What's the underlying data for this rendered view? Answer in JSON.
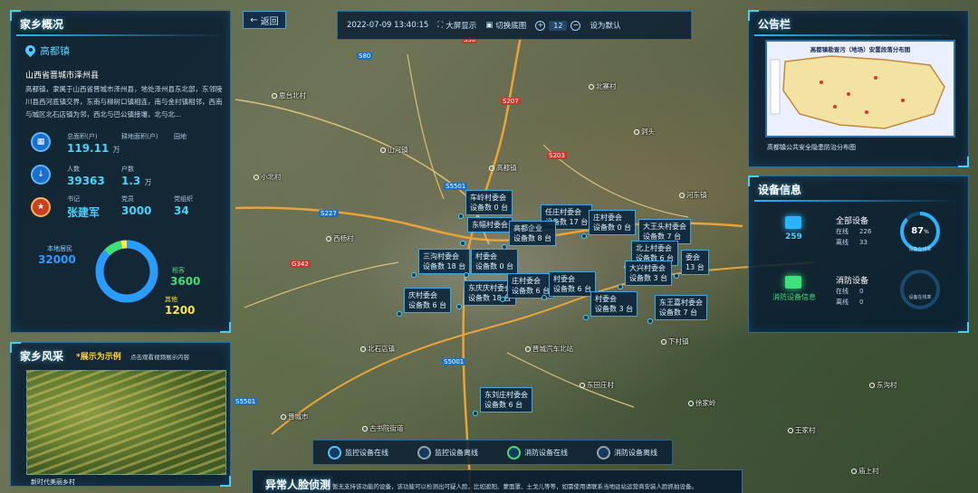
{
  "toolbar": {
    "back_label": "返回",
    "datetime": "2022-07-09 13:40:15",
    "fullscreen_label": "大屏显示",
    "switch_map_label": "切换底图",
    "zoom_level": "12",
    "default_label": "设为默认"
  },
  "home": {
    "title": "家乡概况",
    "town": "高都镇",
    "region": "山西省晋城市泽州县",
    "description": "高都镇，隶属于山西省晋城市泽州县，地处泽州县东北部，东邻陵川县西河底镇交界，东南与柳树口镇相连，南与金村镇相邻，西南与城区北石店镇为邻，西北与巴公镇接壤，北与北...",
    "stats": {
      "area_label": "总面积(户)",
      "area_value": "119.11",
      "area_unit": "万",
      "arable_label": "耕地面积(户)",
      "forest_label": "园地",
      "pop_label": "人数",
      "pop_value": "39363",
      "households_label": "户数",
      "households_value": "1.3",
      "households_unit": "万",
      "secretary_label": "书记",
      "secretary_value": "张建军",
      "party_label": "党员",
      "party_value": "3000",
      "activist_label": "党组织",
      "activist_value": "34"
    },
    "donut": {
      "local_label": "本地居民",
      "local_value": "32000",
      "rent_label": "租客",
      "rent_value": "3600",
      "other_label": "其他",
      "other_value": "1200",
      "local_color": "#2a9cff",
      "rent_color": "#3ee07a",
      "other_color": "#ffe34a"
    }
  },
  "style": {
    "title": "家乡风采",
    "note": "*展示为示例",
    "hint": "点击观看视频展示内容",
    "caption": "新时代美丽乡村"
  },
  "notice": {
    "title": "公告栏",
    "map_title": "高都镇勘查污（地场）安置段落分布图",
    "caption": "高都镇公共安全隐患防治分布图"
  },
  "device": {
    "title": "设备信息",
    "monitor_total": "259",
    "monitor_group": "全部设备",
    "online_label": "在线",
    "online_value": "226",
    "offline_label": "离线",
    "offline_value": "33",
    "online_rate": "87",
    "online_rate_unit": "%",
    "online_rate_label": "设备在线率",
    "fire_group": "消防设备",
    "fire_online": "0",
    "fire_offline": "0",
    "fire_link": "消防设备信息",
    "fire_rate_label": "设备在线率",
    "ring_color": "#2ab4ff",
    "ring_bg": "#1a4a6e"
  },
  "villages": [
    {
      "name": "车岭村委会",
      "count_text": "设备数 0 台"
    },
    {
      "name": "任庄村委会",
      "count_text": "设备数 17 台"
    },
    {
      "name": "庄村委会",
      "count_text": "设备数 0 台"
    },
    {
      "name": "东幅村委会",
      "count_text": ""
    },
    {
      "name": "高都企业",
      "count_text": "设备数 8 台"
    },
    {
      "name": "大王头村委会",
      "count_text": "设备数 7 台"
    },
    {
      "name": "三沟村委会",
      "count_text": "设备数 18 台"
    },
    {
      "name": "村委会",
      "count_text": "设备数 0 台"
    },
    {
      "name": "北上村委会",
      "count_text": "设备数 6 台"
    },
    {
      "name": "大兴村委会",
      "count_text": "设备数 3 台"
    },
    {
      "name": "委会",
      "count_text": "13 台"
    },
    {
      "name": "庆村委会",
      "count_text": "设备数 6 台"
    },
    {
      "name": "东庆庆村委会",
      "count_text": "设备数 18 台"
    },
    {
      "name": "庄村委会",
      "count_text": "设备数 6 台"
    },
    {
      "name": "村委会",
      "count_text": "设备数 6 台"
    },
    {
      "name": "东王嘉村委会",
      "count_text": "设备数 7 台"
    },
    {
      "name": "东刘庄村委会",
      "count_text": "设备数 6 台"
    },
    {
      "name": "村委会",
      "count_text": "设备数 3 台"
    }
  ],
  "legend": {
    "monitor_online": "监控设备在线",
    "monitor_offline": "监控设备离线",
    "fire_online": "消防设备在线",
    "fire_offline": "消防设备离线"
  },
  "face": {
    "title": "异常人脸侦测",
    "desc": "暂无支持该功能的设备，该功能可以检测出可疑人脸，比如遮阳、蒙面罩、土戈儿等等，如需使用请联系当地驻站运营商安装人脸抓拍设备。"
  },
  "map_labels": {
    "roads": [
      "S80",
      "S50",
      "S207",
      "S203",
      "S227",
      "G342",
      "S5501",
      "S5001",
      "S5501"
    ],
    "places": [
      "鹿台北村",
      "北寨村",
      "山河镇",
      "洞头",
      "高都镇",
      "小北村",
      "河东镇",
      "西杨村",
      "晋城汽车北站",
      "北石店镇",
      "下村镇",
      "晋城市",
      "古书院街道",
      "东田庄村",
      "徐家岭",
      "王家村",
      "东沟村",
      "庙上村"
    ]
  }
}
